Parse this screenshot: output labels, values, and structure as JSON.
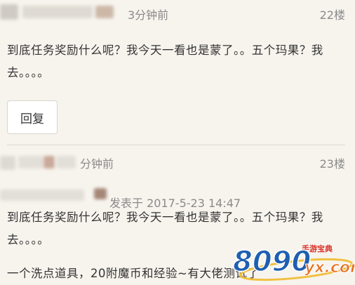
{
  "posts": [
    {
      "time": "3分钟前",
      "floor": "22楼",
      "content_lines": [
        "到底任务奖励什么呢？我今天一看也是蒙了。。五个玛果？我",
        "去。。。。"
      ],
      "reply_label": "回复"
    },
    {
      "time": "分钟前",
      "floor": "23楼"
    }
  ],
  "quote": {
    "posted_at": "发表于 2017-5-23 14:47",
    "content_lines": [
      "到底任务奖励什么呢？我今天一看也是蒙了。。五个玛果？我",
      "去。。。。"
    ],
    "reply_text": "一个洗点道具，20附魔币和经验~有大佬测试了"
  },
  "watermark": {
    "brand": "8090",
    "domain": "yx.com",
    "tagline": "手游宝典",
    "colors": {
      "blue": "#1e5fb0",
      "orange": "#e8701e",
      "red": "#d8332a"
    }
  }
}
